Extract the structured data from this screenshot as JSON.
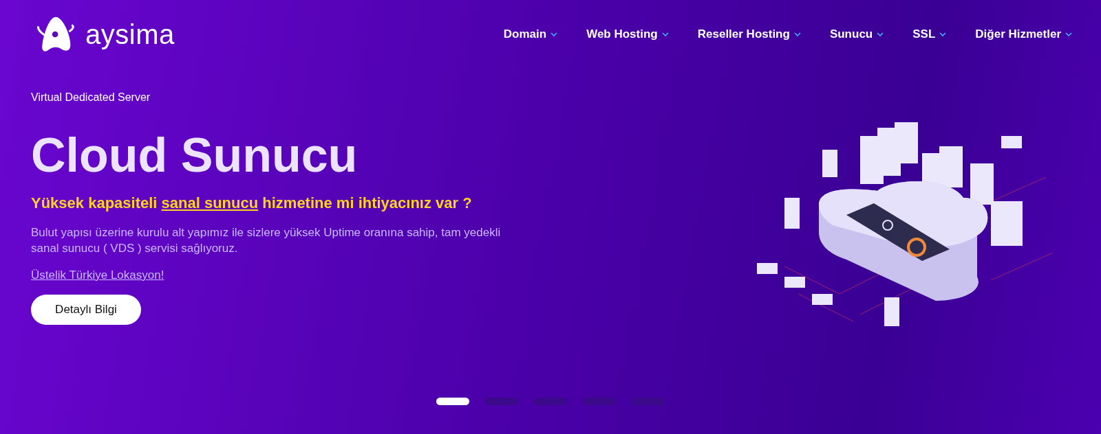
{
  "logo": {
    "text": "aysima"
  },
  "nav": [
    {
      "label": "Domain"
    },
    {
      "label": "Web Hosting"
    },
    {
      "label": "Reseller Hosting"
    },
    {
      "label": "Sunucu"
    },
    {
      "label": "SSL"
    },
    {
      "label": "Diğer Hizmetler"
    }
  ],
  "hero": {
    "eyebrow": "Virtual Dedicated Server",
    "title": "Cloud Sunucu",
    "headline": {
      "before": "Yüksek kapasiteli ",
      "link": "sanal sunucu",
      "after": " hizmetine mi ihtiyacınız var ?"
    },
    "description": "Bulut yapısı üzerine kurulu alt yapımız ile sizlere yüksek Uptime oranına sahip, tam yedekli sanal sunucu ( VDS ) servisi sağlıyoruz.",
    "note_link": "Üstelik Türkiye Lokasyon!",
    "button": "Detaylı Bilgi"
  },
  "slider_dots": [
    {
      "selected": true
    },
    {
      "selected": false
    },
    {
      "selected": false
    },
    {
      "selected": false
    },
    {
      "selected": false
    }
  ]
}
